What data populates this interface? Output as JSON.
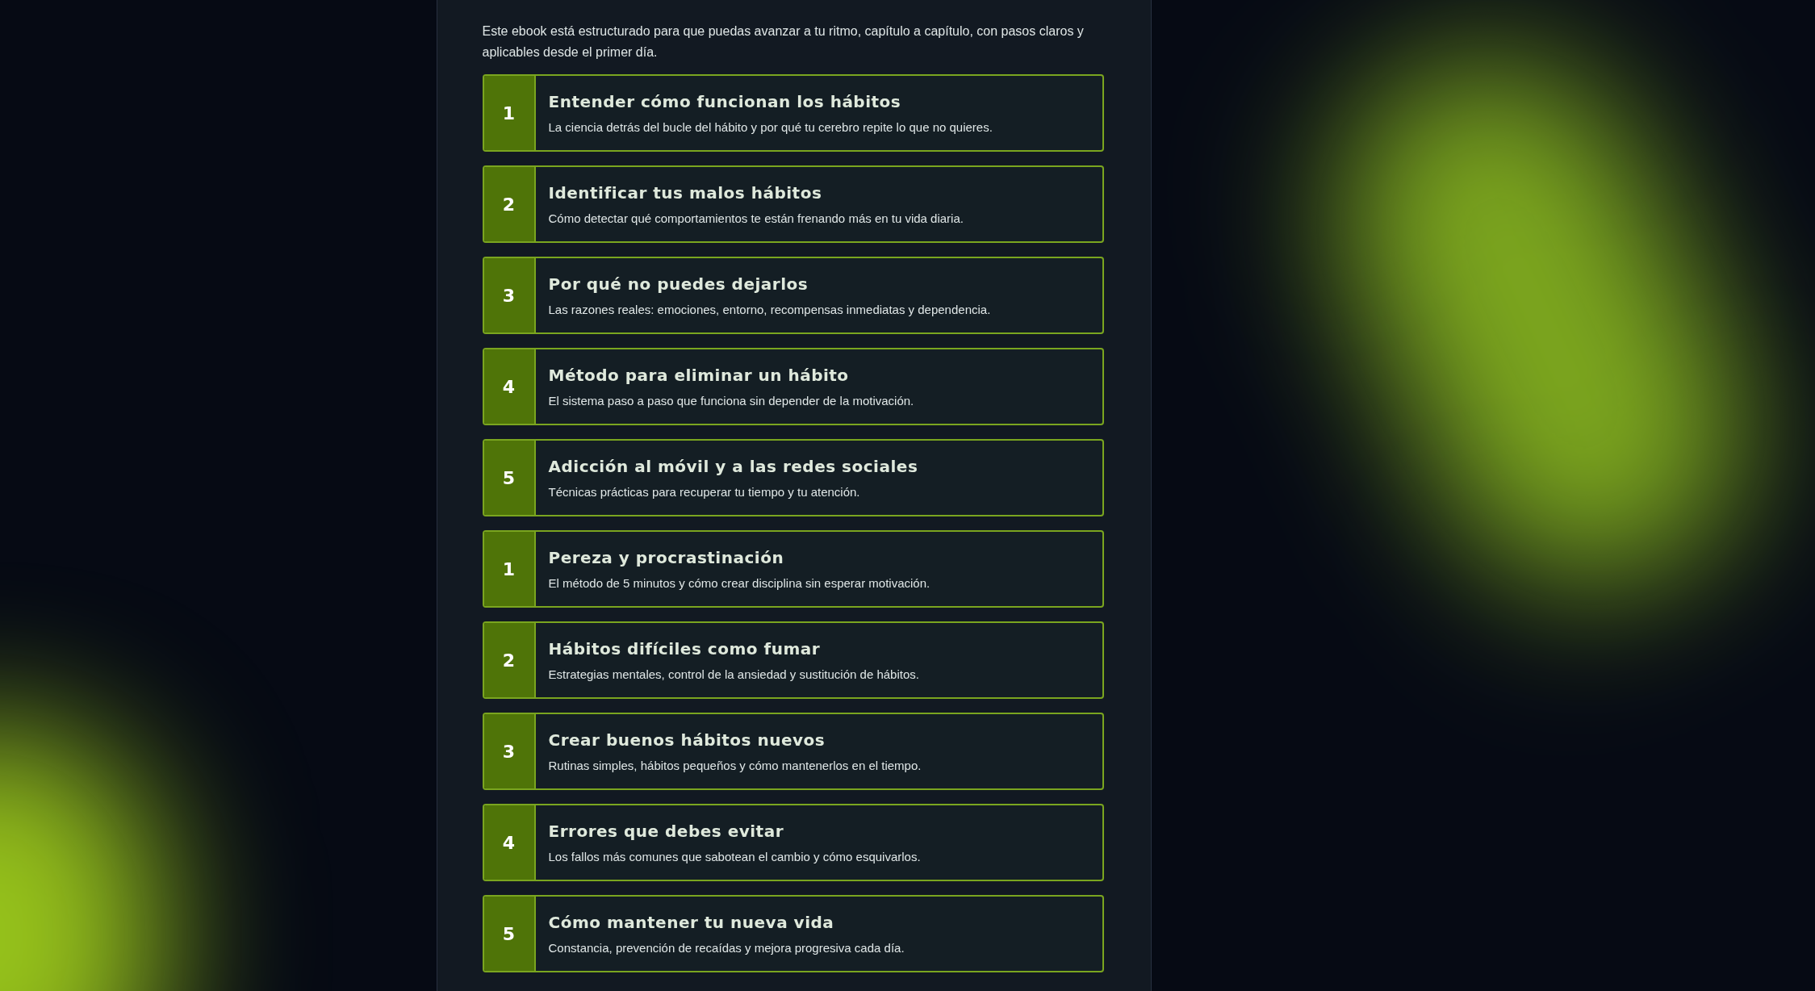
{
  "intro": "Este ebook está estructurado para que puedas avanzar a tu ritmo, capítulo a capítulo, con pasos claros y aplicables desde el primer día.",
  "chapters": [
    {
      "number": "1",
      "title": "Entender cómo funcionan los hábitos",
      "description": "La ciencia detrás del bucle del hábito y por qué tu cerebro repite lo que no quieres."
    },
    {
      "number": "2",
      "title": "Identificar tus malos hábitos",
      "description": "Cómo detectar qué comportamientos te están frenando más en tu vida diaria."
    },
    {
      "number": "3",
      "title": "Por qué no puedes dejarlos",
      "description": "Las razones reales: emociones, entorno, recompensas inmediatas y dependencia."
    },
    {
      "number": "4",
      "title": "Método para eliminar un hábito",
      "description": "El sistema paso a paso que funciona sin depender de la motivación."
    },
    {
      "number": "5",
      "title": "Adicción al móvil y a las redes sociales",
      "description": "Técnicas prácticas para recuperar tu tiempo y tu atención."
    },
    {
      "number": "1",
      "title": "Pereza y procrastinación",
      "description": "El método de 5 minutos y cómo crear disciplina sin esperar motivación."
    },
    {
      "number": "2",
      "title": "Hábitos difíciles como fumar",
      "description": "Estrategias mentales, control de la ansiedad y sustitución de hábitos."
    },
    {
      "number": "3",
      "title": "Crear buenos hábitos nuevos",
      "description": "Rutinas simples, hábitos pequeños y cómo mantenerlos en el tiempo."
    },
    {
      "number": "4",
      "title": "Errores que debes evitar",
      "description": "Los fallos más comunes que sabotean el cambio y cómo esquivarlos."
    },
    {
      "number": "5",
      "title": "Cómo mantener tu nueva vida",
      "description": "Constancia, prevención de recaídas y mejora progresiva cada día."
    }
  ]
}
